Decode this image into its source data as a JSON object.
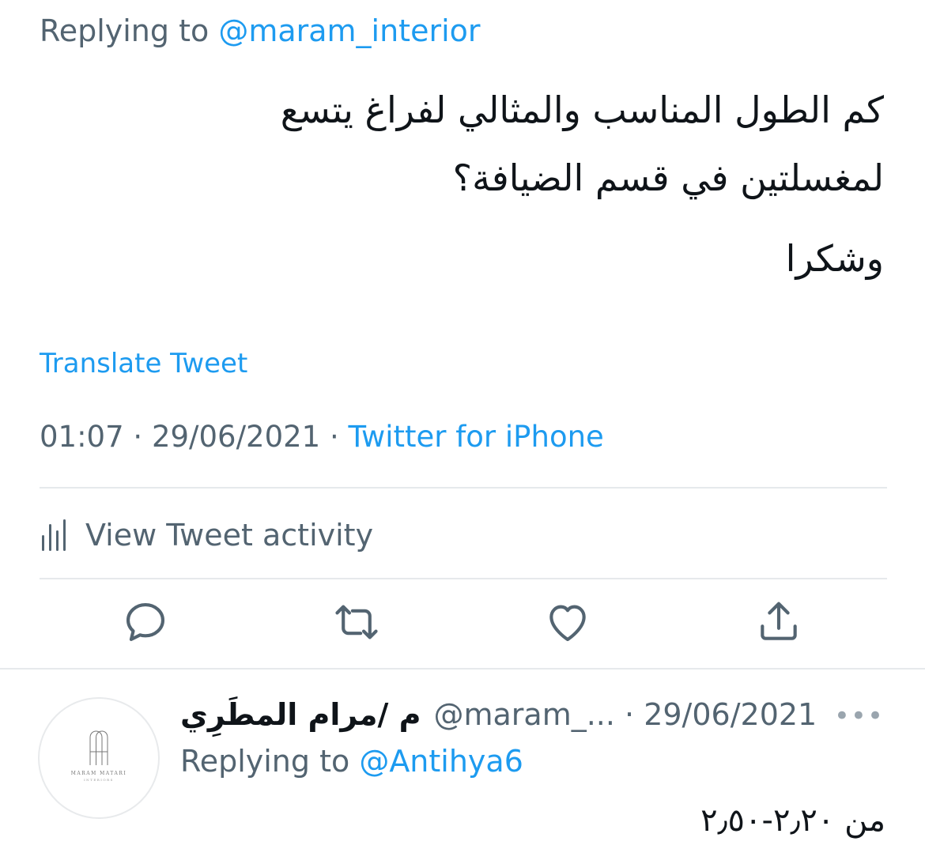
{
  "tweet": {
    "replying_prefix": "Replying to ",
    "replying_handle": "@maram_interior",
    "text_lines": [
      "كم الطول المناسب والمثالي لفراغ يتسع",
      "لمغسلتين في قسم الضيافة؟",
      "وشكرا"
    ],
    "translate_label": "Translate Tweet",
    "time": "01:07",
    "date": "29/06/2021",
    "separator": " · ",
    "source": "Twitter for iPhone",
    "activity_label": "View Tweet activity"
  },
  "actions": {
    "reply_icon": "reply-icon",
    "retweet_icon": "retweet-icon",
    "like_icon": "heart-icon",
    "share_icon": "share-icon"
  },
  "reply": {
    "avatar_brand": "MARAM MATARI",
    "avatar_sub": "INTERIORS",
    "name": "م /مرام المطَرِي",
    "handle": "@maram_...",
    "separator": " · ",
    "date": "29/06/2021",
    "more_label": "•••",
    "replying_prefix": "Replying to ",
    "replying_handle": "@Antihya6",
    "text": "من ٢٫٢٠-٢٫٥٠"
  },
  "colors": {
    "text": "#0f1419",
    "secondary": "#536471",
    "accent": "#1d9bf0",
    "divider": "#e6e9ec"
  }
}
